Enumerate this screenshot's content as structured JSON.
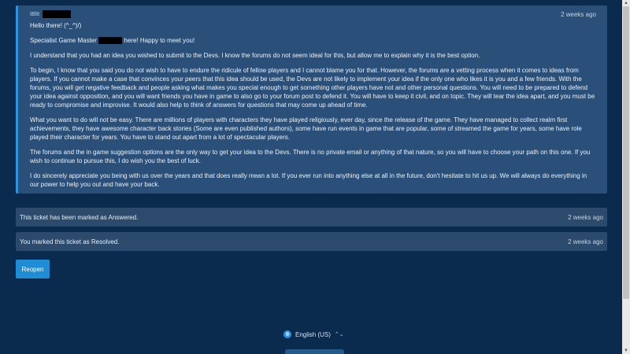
{
  "message": {
    "author_tag": "IBlIt",
    "time": "2 weeks ago",
    "greeting": "Hello there! (^_^)/)",
    "intro_before": "Specialist Game Master",
    "intro_after": "here! Happy to meet you!",
    "paragraphs": [
      "I understand that you had an idea you wished to submit to the Devs. I know the forums do not seem ideal for this, but allow me to explain why it is the best option.",
      "To begin, I know that you said you do not wish to have to endure the ridicule of fellow players and I cannot blame you for that. However, the forums are a vetting process when it comes to ideas from players. If you cannot make a case that convinces your peers that this idea should be used, the Devs are not likely to implement your idea if the only one who likes it is you and a few friends. With the forums, you will get negative feedback and people asking what makes you special enough to get something other players have not and other personal questions. You will need to be prepared to defend your idea against opposition, and you will want friends you have in game to also go to your forum post to defend it. You will have to keep it civil, and on topic. They will tear the idea apart, and you must be ready to compromise and improvise. It would also help to think of answers for questions that may come up ahead of time.",
      "What you want to do will not be easy. There are millions of players with characters they have played religiously, ever day, since the release of the game. They have managed to collect realm first achievements, they have awesome character back stories  (Some are even published authors), some have run events in game that are popular, some of streamed the game for years, some have role played their character for years. You have to stand out apart from a lot of spectacular players.",
      "The forums and the in game suggestion options are the only way to get your idea to the Devs. There is no private email or anything of that nature, so you will have to choose your path on this one. If you wish to continue to pursue this, I do wish you the best of luck.",
      "I do sincerely appreciate you being with us over the years and that does really mean a lot. If you ever run into anything else at all in the future, don't hesitate to hit us up. We will always do everything in our power to help you out and have your back."
    ]
  },
  "status_answered": {
    "text": "This ticket has been marked as Answered.",
    "time": "2 weeks ago"
  },
  "status_resolved": {
    "text": "You marked this ticket as Resolved.",
    "time": "2 weeks ago"
  },
  "reopen_label": "Reopen",
  "language": {
    "label": "English (US)",
    "caret": "⌃⌄"
  },
  "colors": {
    "background": "#0a2a4e",
    "accent": "#2e93e0",
    "card": "#2a4f78"
  }
}
